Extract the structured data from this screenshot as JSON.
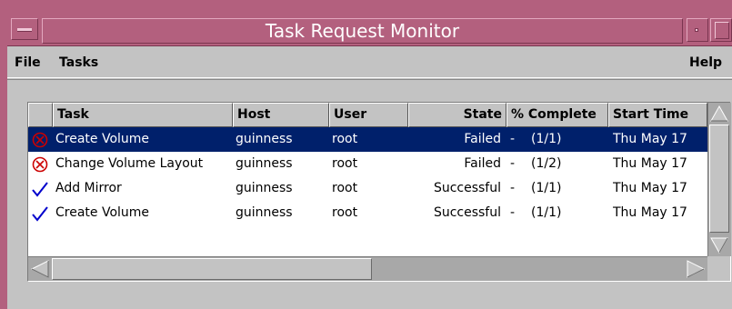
{
  "window": {
    "title": "Task Request Monitor"
  },
  "menubar": {
    "file": "File",
    "tasks": "Tasks",
    "help": "Help"
  },
  "table": {
    "columns": [
      "Task",
      "Host",
      "User",
      "State",
      "% Complete",
      "Start Time"
    ],
    "rows": [
      {
        "status_icon": "failed-circle-x-icon",
        "task": "Create Volume",
        "host": "guinness",
        "user": "root",
        "state": "Failed",
        "dash": "-",
        "complete": "(1/1)",
        "start": "Thu May 17",
        "selected": true
      },
      {
        "status_icon": "failed-circle-x-icon",
        "task": "Change Volume Layout",
        "host": "guinness",
        "user": "root",
        "state": "Failed",
        "dash": "-",
        "complete": "(1/2)",
        "start": "Thu May 17",
        "selected": false
      },
      {
        "status_icon": "success-checkmark-icon",
        "task": "Add Mirror",
        "host": "guinness",
        "user": "root",
        "state": "Successful",
        "dash": "-",
        "complete": "(1/1)",
        "start": "Thu May 17",
        "selected": false
      },
      {
        "status_icon": "success-checkmark-icon",
        "task": "Create Volume",
        "host": "guinness",
        "user": "root",
        "state": "Successful",
        "dash": "-",
        "complete": "(1/1)",
        "start": "Thu May 17",
        "selected": false
      }
    ]
  },
  "colors": {
    "titlebar": "#b3607e",
    "selection": "#00206b",
    "failed": "#cc0000",
    "success": "#0000cc"
  }
}
